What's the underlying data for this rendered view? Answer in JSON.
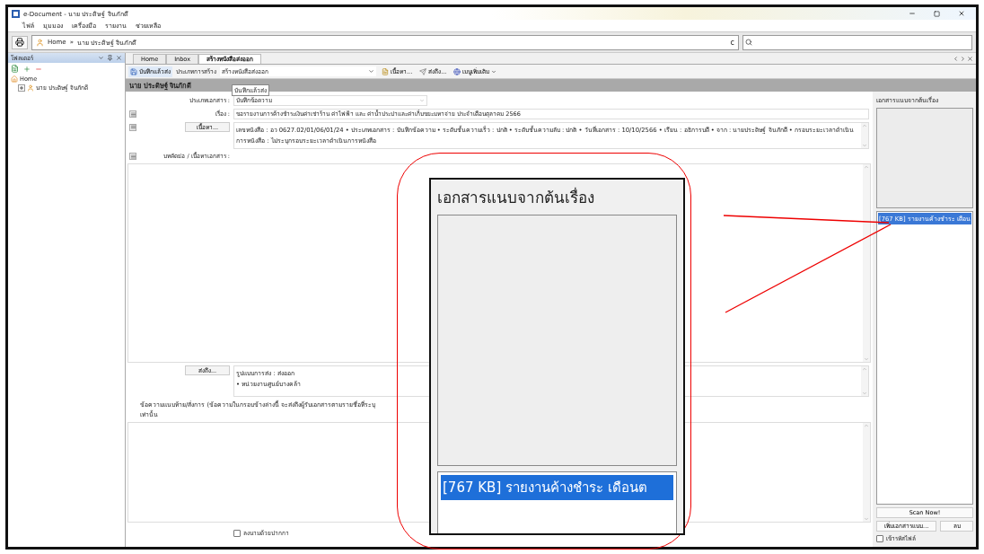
{
  "window": {
    "title": "e-Document - นาย ประดิษฐ์ จินภักดี"
  },
  "menu": [
    "ไฟล์",
    "มุมมอง",
    "เครื่องมือ",
    "รายงาน",
    "ช่วยเหลือ"
  ],
  "address": {
    "crumbs": [
      "Home",
      "นาย ประดิษฐ์ จินภักดี"
    ],
    "separator": "»",
    "reload": "c"
  },
  "folders_panel": {
    "title": "โฟลเดอร์",
    "tree": [
      {
        "label": "Home",
        "children": [
          {
            "label": "นาย ประดิษฐ์ จินภักดี",
            "expanded": false
          }
        ]
      }
    ]
  },
  "tabs": [
    {
      "label": "Home",
      "selected": false
    },
    {
      "label": "Inbox",
      "selected": false
    },
    {
      "label": "สร้างหนังสือส่งออก",
      "selected": true
    }
  ],
  "toolbar": {
    "save": "บันทึกแล้วส่ง",
    "create_type_label": "ประเภทการสร้าง",
    "create_type_value": "สร้างหนังสือส่งออก",
    "content": "เนื้อหา...",
    "send_to": "ส่งถึง...",
    "more": "เมนูเพิ่มเติม"
  },
  "header": "นาย ประดิษฐ์ จินภักดี",
  "tooltip": "บันทึกแล้วส่ง",
  "form": {
    "doc_type_label": "ประเภทเอกสาร :",
    "doc_type_value": "บันทึกข้อความ",
    "subject_label": "เรื่อง :",
    "subject_value": "ขอรายงานการค้างชำระเงินค่าเช่าร้าน ค่าไฟฟ้า และ ค่าน้ำประปาและค่าเก็บขยะมหาจ่าย ประจำเดือนตุลาคม 2566",
    "content_button": "เนื้อหา...",
    "content_lines": [
      "เลขหนังสือ : อว 0627.02/01/06/01/24 • ประเภทเอกสาร : บันทึกข้อความ • ระดับชั้นความเร็ว : ปกติ • ระดับชั้นความลับ : ปกติ • วันที่เอกสาร : 10/10/2566 • เรียน : อธิการบดี • จาก : นายประดิษฐ์  จินภักดี • กรอบระยะเวลาดำเนิน",
      "การหนังสือ : ไม่ระบุกรอบระยะเวลาดำเนินการหนังสือ"
    ],
    "abstract_label": "บทคัดย่อ / เนื้อหาเอกสาร :",
    "send_button": "ส่งถึง...",
    "send_lines": [
      "รูปแบบการส่ง : ส่งออก",
      "• หน่วยงานศูนย์บางคล้า"
    ],
    "note_label": "ข้อความแนบท้าย/สั่งการ (ข้อความในกรอบข้างล่างนี้ จะส่งถึงผู้รับเอกสารตามรายชื่อที่ระบุเท่านั้น",
    "sign_checkbox": {
      "label": "ลงนามด้วยปากกา",
      "checked": false
    }
  },
  "attachments_panel": {
    "title": "เอกสารแนบจากต้นเรื่อง",
    "items": [
      {
        "label": "[767 KB] รายงานค้างชำระ เดือน",
        "selected": true
      }
    ],
    "scan": "Scan Now!",
    "add": "เพิ่มเอกสารแนบ...",
    "delete": "ลบ",
    "encrypt_checkbox": {
      "label": "เข้ารหัสไฟล์",
      "checked": false
    }
  },
  "callout": {
    "title": "เอกสารแนบจากต้นเรื่อง",
    "item": {
      "label": "[767 KB] รายงานค้างชำระ เดือนต",
      "selected": true
    }
  }
}
